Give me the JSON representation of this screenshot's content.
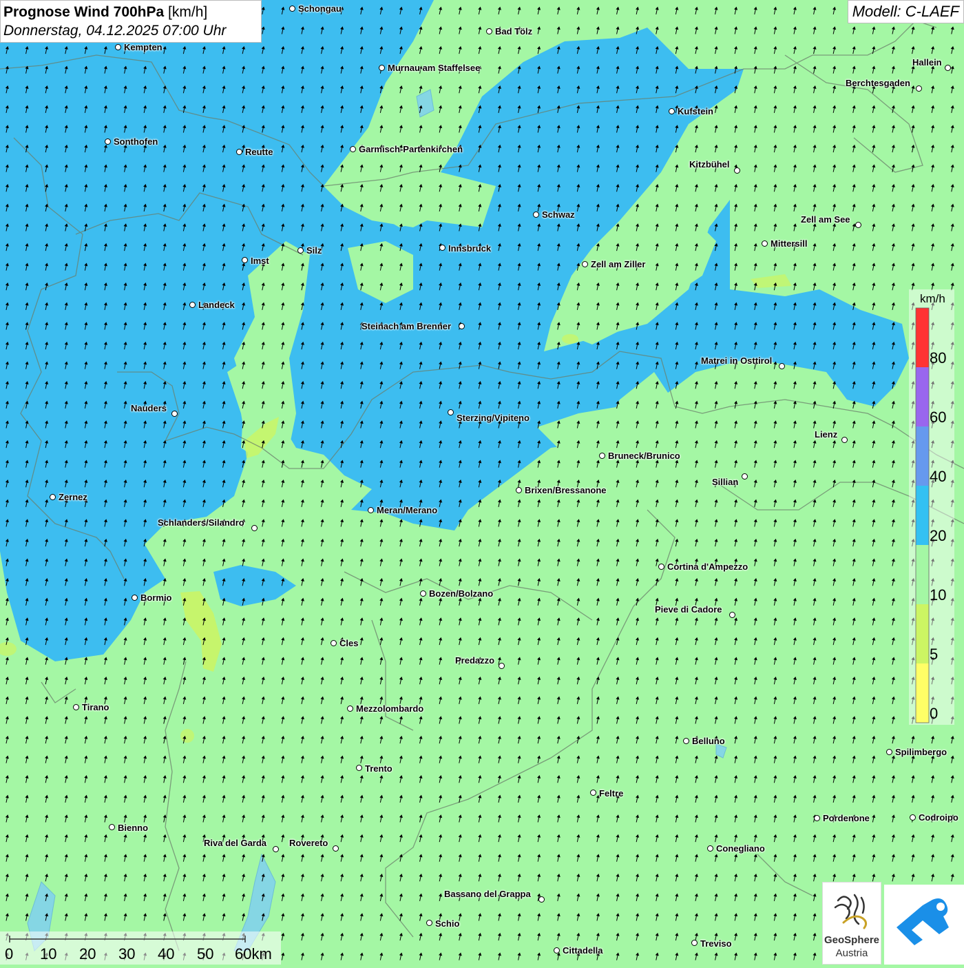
{
  "title": {
    "main_bold": "Prognose Wind 700hPa",
    "main_unit": "[km/h]",
    "datetime": "Donnerstag, 04.12.2025 07:00 Uhr"
  },
  "model": "Modell: C-LAEF",
  "legend": {
    "unit": "km/h",
    "labels": [
      "80",
      "60",
      "40",
      "20",
      "10",
      "5",
      "0"
    ],
    "colors": [
      "#ff3333",
      "#9966ee",
      "#6699ee",
      "#33c1f2",
      "#a4f7a4",
      "#ccf563",
      "#ffff66"
    ]
  },
  "colors": {
    "calm_green": "#a4f7a4",
    "medium_blue": "#3dbdf0",
    "light_yellow": "#ccf563",
    "arrow": "#000000"
  },
  "wind_direction": "north-northwest",
  "scale_bar": {
    "labels": [
      "0",
      "10",
      "20",
      "30",
      "40",
      "50",
      "60km"
    ]
  },
  "logos": {
    "geosphere_line1": "GeoSphere",
    "geosphere_line2": "Austria",
    "second_logo_icon": "wetter-logo-icon"
  },
  "cities": [
    {
      "name": "Schongau",
      "dot": [
        425,
        13
      ],
      "lbl": [
        433,
        13
      ]
    },
    {
      "name": "Kempten",
      "dot": [
        172,
        69
      ],
      "lbl": [
        180,
        69
      ]
    },
    {
      "name": "Bad Tölz",
      "dot": [
        711,
        46
      ],
      "lbl": [
        719,
        46
      ]
    },
    {
      "name": "Murnau am Staffelsee",
      "dot": [
        555,
        99
      ],
      "lbl": [
        563,
        99
      ]
    },
    {
      "name": "Hallein",
      "dot": [
        1377,
        99
      ],
      "lbl": [
        1325,
        91
      ]
    },
    {
      "name": "Berchtesgaden",
      "dot": [
        1335,
        129
      ],
      "lbl": [
        1228,
        121
      ]
    },
    {
      "name": "Kufstein",
      "dot": [
        976,
        162
      ],
      "lbl": [
        984,
        162
      ]
    },
    {
      "name": "Sonthofen",
      "dot": [
        157,
        206
      ],
      "lbl": [
        165,
        206
      ]
    },
    {
      "name": "Reutte",
      "dot": [
        348,
        221
      ],
      "lbl": [
        356,
        221
      ]
    },
    {
      "name": "Garmisch-Partenkirchen",
      "dot": [
        513,
        217
      ],
      "lbl": [
        521,
        217
      ]
    },
    {
      "name": "Kitzbühel",
      "dot": [
        1071,
        248
      ],
      "lbl": [
        1001,
        239
      ]
    },
    {
      "name": "Schwaz",
      "dot": [
        779,
        312
      ],
      "lbl": [
        787,
        312
      ]
    },
    {
      "name": "Zell am See",
      "dot": [
        1247,
        327
      ],
      "lbl": [
        1163,
        319
      ]
    },
    {
      "name": "Mittersill",
      "dot": [
        1111,
        354
      ],
      "lbl": [
        1119,
        354
      ]
    },
    {
      "name": "Silz",
      "dot": [
        437,
        364
      ],
      "lbl": [
        445,
        364
      ]
    },
    {
      "name": "Innsbruck",
      "dot": [
        643,
        360
      ],
      "lbl": [
        651,
        361
      ]
    },
    {
      "name": "Imst",
      "dot": [
        356,
        378
      ],
      "lbl": [
        364,
        379
      ]
    },
    {
      "name": "Zell am Ziller",
      "dot": [
        850,
        384
      ],
      "lbl": [
        858,
        384
      ]
    },
    {
      "name": "Landeck",
      "dot": [
        280,
        443
      ],
      "lbl": [
        288,
        443
      ]
    },
    {
      "name": "Steinach am Brenner",
      "dot": [
        671,
        474
      ],
      "lbl": [
        525,
        474
      ]
    },
    {
      "name": "Matrei in Osttirol",
      "dot": [
        1136,
        532
      ],
      "lbl": [
        1018,
        524
      ]
    },
    {
      "name": "Nauders",
      "dot": [
        254,
        601
      ],
      "lbl": [
        190,
        593
      ]
    },
    {
      "name": "Sterzing/Vipiteno",
      "dot": [
        655,
        599
      ],
      "lbl": [
        663,
        607
      ]
    },
    {
      "name": "Lienz",
      "dot": [
        1227,
        639
      ],
      "lbl": [
        1183,
        631
      ]
    },
    {
      "name": "Bruneck/Brunico",
      "dot": [
        875,
        662
      ],
      "lbl": [
        883,
        662
      ]
    },
    {
      "name": "Sillian",
      "dot": [
        1082,
        692
      ],
      "lbl": [
        1034,
        700
      ]
    },
    {
      "name": "Brixen/Bressanone",
      "dot": [
        754,
        712
      ],
      "lbl": [
        762,
        712
      ]
    },
    {
      "name": "Zernez",
      "dot": [
        77,
        722
      ],
      "lbl": [
        85,
        722
      ]
    },
    {
      "name": "Meran/Merano",
      "dot": [
        539,
        741
      ],
      "lbl": [
        547,
        741
      ]
    },
    {
      "name": "Schlanders/Silandro",
      "dot": [
        370,
        767
      ],
      "lbl": [
        229,
        759
      ]
    },
    {
      "name": "Cortina d'Ampezzo",
      "dot": [
        961,
        823
      ],
      "lbl": [
        969,
        823
      ]
    },
    {
      "name": "Bozen/Bolzano",
      "dot": [
        615,
        862
      ],
      "lbl": [
        623,
        862
      ]
    },
    {
      "name": "Bormio",
      "dot": [
        196,
        868
      ],
      "lbl": [
        204,
        868
      ]
    },
    {
      "name": "Pieve di Cadore",
      "dot": [
        1064,
        893
      ],
      "lbl": [
        951,
        885
      ]
    },
    {
      "name": "Cles",
      "dot": [
        485,
        934
      ],
      "lbl": [
        493,
        934
      ]
    },
    {
      "name": "Predazzo",
      "dot": [
        729,
        967
      ],
      "lbl": [
        661,
        959
      ]
    },
    {
      "name": "Tirano",
      "dot": [
        111,
        1027
      ],
      "lbl": [
        119,
        1027
      ]
    },
    {
      "name": "Mezzolombardo",
      "dot": [
        509,
        1029
      ],
      "lbl": [
        517,
        1029
      ]
    },
    {
      "name": "Belluno",
      "dot": [
        997,
        1076
      ],
      "lbl": [
        1005,
        1076
      ]
    },
    {
      "name": "Spilimbergo",
      "dot": [
        1292,
        1092
      ],
      "lbl": [
        1300,
        1092
      ]
    },
    {
      "name": "Trento",
      "dot": [
        522,
        1115
      ],
      "lbl": [
        530,
        1116
      ]
    },
    {
      "name": "Feltre",
      "dot": [
        862,
        1151
      ],
      "lbl": [
        870,
        1152
      ]
    },
    {
      "name": "Pordenone",
      "dot": [
        1187,
        1188
      ],
      "lbl": [
        1195,
        1188
      ]
    },
    {
      "name": "Codroipo",
      "dot": [
        1326,
        1187
      ],
      "lbl": [
        1334,
        1187
      ]
    },
    {
      "name": "Bienno",
      "dot": [
        163,
        1201
      ],
      "lbl": [
        171,
        1202
      ]
    },
    {
      "name": "Riva del Garda",
      "dot": [
        401,
        1233
      ],
      "lbl": [
        296,
        1224
      ]
    },
    {
      "name": "Rovereto",
      "dot": [
        488,
        1232
      ],
      "lbl": [
        420,
        1224
      ]
    },
    {
      "name": "Conegliano",
      "dot": [
        1032,
        1232
      ],
      "lbl": [
        1040,
        1232
      ]
    },
    {
      "name": "Bassano del Grappa",
      "dot": [
        787,
        1306
      ],
      "lbl": [
        645,
        1298
      ]
    },
    {
      "name": "Schio",
      "dot": [
        624,
        1340
      ],
      "lbl": [
        632,
        1341
      ]
    },
    {
      "name": "Treviso",
      "dot": [
        1009,
        1369
      ],
      "lbl": [
        1017,
        1370
      ]
    },
    {
      "name": "Cittadella",
      "dot": [
        809,
        1380
      ],
      "lbl": [
        817,
        1380
      ]
    }
  ]
}
